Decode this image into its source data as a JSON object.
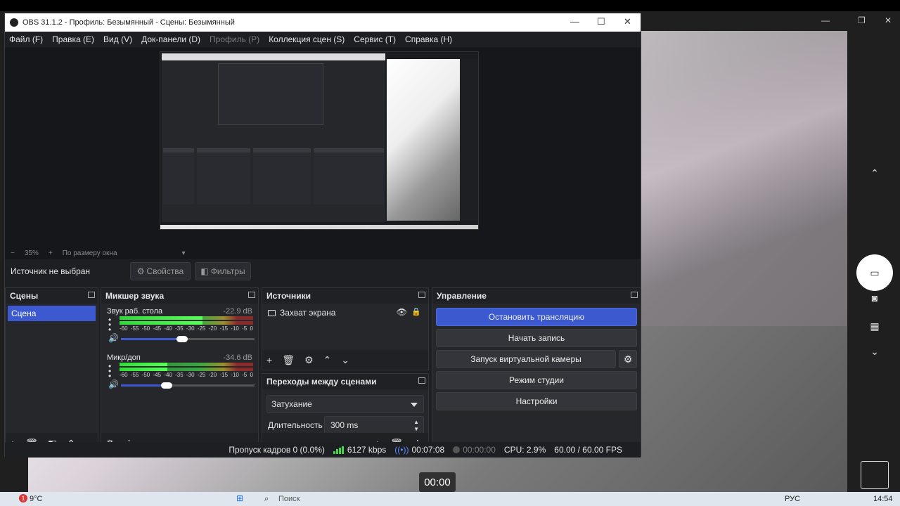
{
  "obs": {
    "title": "OBS 31.1.2 - Профиль: Безымянный - Сцены: Безымянный",
    "menu": [
      {
        "label": "Файл (F)",
        "enabled": true
      },
      {
        "label": "Правка (E)",
        "enabled": true
      },
      {
        "label": "Вид (V)",
        "enabled": true
      },
      {
        "label": "Док-панели (D)",
        "enabled": true
      },
      {
        "label": "Профиль (P)",
        "enabled": false
      },
      {
        "label": "Коллекция сцен (S)",
        "enabled": true
      },
      {
        "label": "Сервис (T)",
        "enabled": true
      },
      {
        "label": "Справка (H)",
        "enabled": true
      }
    ],
    "zoom": {
      "minus": "−",
      "value": "35%",
      "plus": "+",
      "fit": "По размеру окна"
    },
    "source_bar": {
      "label": "Источник не выбран",
      "properties": "Свойства",
      "filters": "Фильтры"
    },
    "scenes": {
      "title": "Сцены",
      "items": [
        "Сцена"
      ]
    },
    "mixer": {
      "title": "Микшер звука",
      "tracks": [
        {
          "name": "Звук раб. стола",
          "db": "-22.9 dB",
          "level": 0.62,
          "volume": 0.46
        },
        {
          "name": "Микр/доп",
          "db": "-34.6 dB",
          "level": 0.36,
          "volume": 0.34
        }
      ],
      "scale": [
        "-60",
        "-55",
        "-50",
        "-45",
        "-40",
        "-35",
        "-30",
        "-25",
        "-20",
        "-15",
        "-10",
        "-5",
        "0"
      ]
    },
    "sources": {
      "title": "Источники",
      "items": [
        "Захват экрана"
      ]
    },
    "transitions": {
      "title": "Переходы между сценами",
      "selected": "Затухание",
      "duration_label": "Длительность",
      "duration_value": "300 ms"
    },
    "controls": {
      "title": "Управление",
      "stop_stream": "Остановить трансляцию",
      "start_record": "Начать запись",
      "virtual_cam": "Запуск виртуальной камеры",
      "studio_mode": "Режим студии",
      "settings": "Настройки"
    },
    "status": {
      "dropped": "Пропуск кадров 0 (0.0%)",
      "bitrate": "6127 kbps",
      "stream_time": "00:07:08",
      "record_time": "00:00:00",
      "cpu": "CPU: 2.9%",
      "fps": "60.00 / 60.00 FPS"
    }
  },
  "camera": {
    "timer": "00:00"
  },
  "taskbar": {
    "weather": "9°C",
    "badge": "1",
    "search": "Поиск",
    "lang": "РУС",
    "clock": "14:54"
  },
  "colors": {
    "accent": "#3c59cf",
    "panel": "#26272b",
    "background": "#1e1f22",
    "meter_green": "#3aa843",
    "meter_red": "#8a2a2a"
  }
}
